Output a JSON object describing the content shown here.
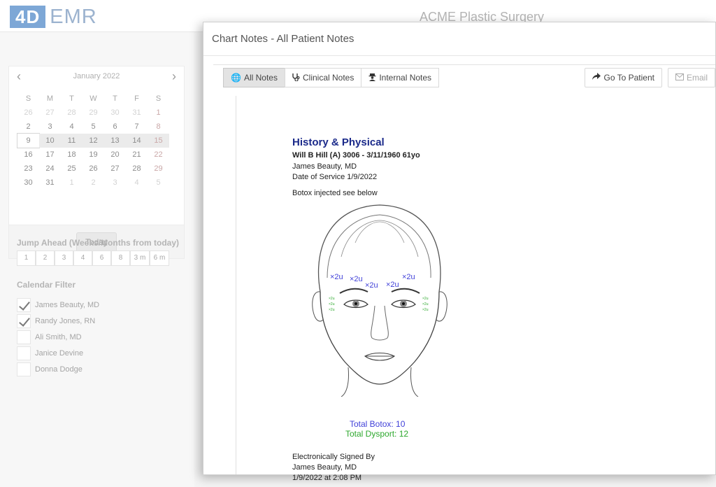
{
  "app": {
    "logo_mark": "4D",
    "logo_text": "EMR",
    "practice": "ACME Plastic Surgery"
  },
  "calendar": {
    "month": "January 2022",
    "prev": "‹",
    "next": "›",
    "dow": [
      "S",
      "M",
      "T",
      "W",
      "T",
      "F",
      "S"
    ],
    "weeks": [
      [
        "26",
        "27",
        "28",
        "29",
        "30",
        "31",
        "1"
      ],
      [
        "2",
        "3",
        "4",
        "5",
        "6",
        "7",
        "8"
      ],
      [
        "9",
        "10",
        "11",
        "12",
        "13",
        "14",
        "15"
      ],
      [
        "16",
        "17",
        "18",
        "19",
        "20",
        "21",
        "22"
      ],
      [
        "23",
        "24",
        "25",
        "26",
        "27",
        "28",
        "29"
      ],
      [
        "30",
        "31",
        "1",
        "2",
        "3",
        "4",
        "5"
      ]
    ],
    "today_label": "Today"
  },
  "jump": {
    "title": "Jump Ahead (Weeks/Months from today)",
    "options": [
      "1",
      "2",
      "3",
      "4",
      "6",
      "8",
      "3 m",
      "6 m"
    ]
  },
  "filter": {
    "title": "Calendar Filter",
    "items": [
      {
        "label": "James Beauty, MD",
        "checked": true
      },
      {
        "label": "Randy Jones, RN",
        "checked": true
      },
      {
        "label": "Ali Smith, MD",
        "checked": false
      },
      {
        "label": "Janice Devine",
        "checked": false
      },
      {
        "label": "Donna Dodge",
        "checked": false
      }
    ]
  },
  "modal": {
    "title": "Chart Notes - All Patient Notes",
    "tabs": {
      "all": "All Notes",
      "clinical": "Clinical Notes",
      "internal": "Internal Notes"
    },
    "actions": {
      "go": "Go To Patient",
      "email": "Email"
    }
  },
  "note": {
    "title": "History & Physical",
    "patient": "Will B Hill (A) 3006  -  3/11/1960  61yo",
    "provider": "James Beauty, MD",
    "dos": "Date of Service 1/9/2022",
    "summary": "Botox injected see below",
    "injections": {
      "units": "×2u",
      "small": "×2u"
    },
    "total_botox": "Total Botox: 10",
    "total_dysport": "Total Dysport: 12",
    "signed_by": "Electronically Signed By",
    "signer": "James Beauty, MD",
    "signed_at": "1/9/2022 at 2:08 PM"
  },
  "colors": {
    "title_blue": "#1b2a8a",
    "botox": "#3f3fd8",
    "dysport": "#2da82d"
  }
}
